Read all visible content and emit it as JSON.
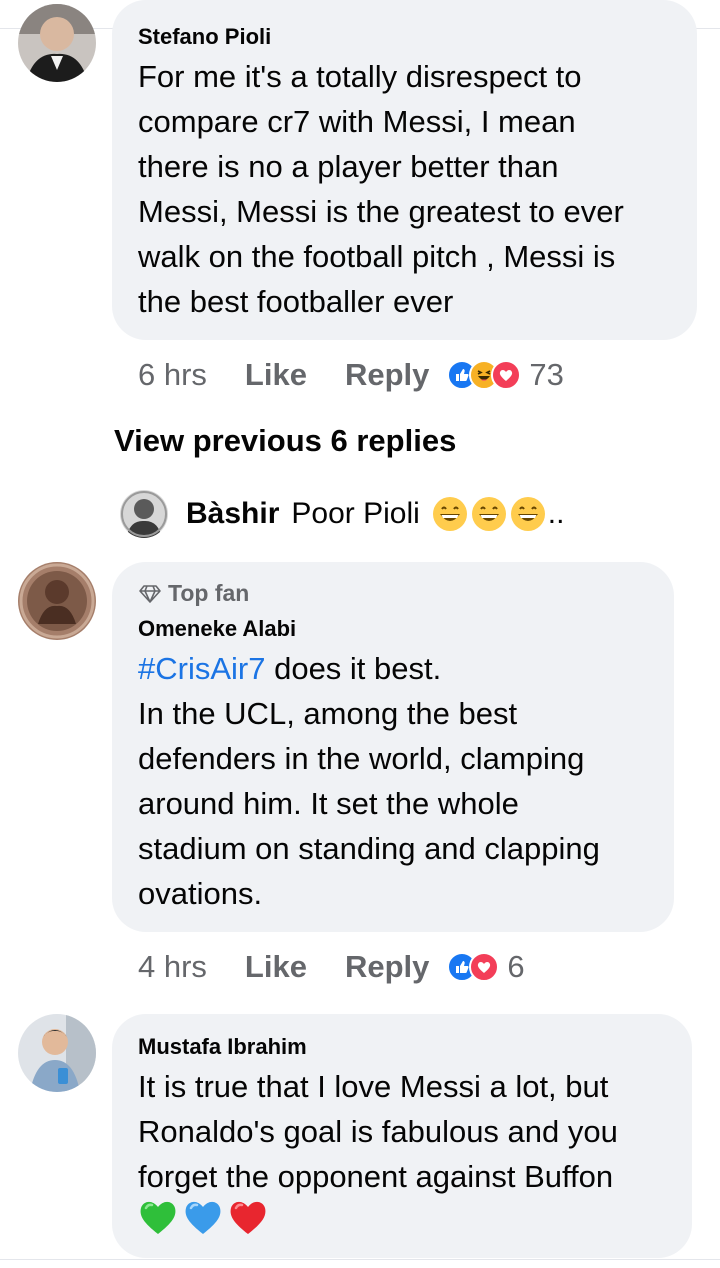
{
  "comments": [
    {
      "author": "Stefano Pioli",
      "lines": [
        "For me it's a totally disrespect to",
        "compare cr7 with Messi, I mean",
        "there is no a player better than",
        "Messi, Messi is the greatest to ever",
        "walk on the football pitch , Messi is",
        "the best footballer ever"
      ],
      "time": "6 hrs",
      "like_label": "Like",
      "reply_label": "Reply",
      "reactions": [
        "like-icon",
        "haha-icon",
        "love-icon"
      ],
      "reaction_count": "73"
    },
    {
      "badge_icon": "diamond-icon",
      "badge": "Top fan",
      "author": "Omeneke Alabi",
      "hashtag": "#CrisAir7",
      "first_line_rest": " does it best.",
      "lines": [
        "In the UCL, among the best",
        "defenders in the world, clamping",
        "around him. It set the whole",
        "stadium on standing and clapping",
        "ovations."
      ],
      "time": "4 hrs",
      "like_label": "Like",
      "reply_label": "Reply",
      "reactions": [
        "like-icon",
        "love-icon"
      ],
      "reaction_count": "6"
    },
    {
      "author": "Mustafa Ibrahim",
      "lines": [
        "It is true that I love Messi a lot, but",
        "Ronaldo's goal is fabulous and you",
        "forget the opponent against Buffon"
      ],
      "emojis": [
        "green-heart-icon",
        "blue-heart-icon",
        "red-heart-icon"
      ]
    }
  ],
  "view_previous": "View previous 6 replies",
  "reply_preview": {
    "author": "Bàshir",
    "text": "Poor Pioli",
    "emojis": [
      "grinning-face-icon",
      "grinning-face-icon",
      "grinning-face-icon"
    ],
    "ellipsis": ".."
  },
  "colors": {
    "bubble": "#f0f2f5",
    "like_blue": "#1877f2",
    "love_red": "#f33e58",
    "haha_yellow": "#f7b125",
    "hashtag_blue": "#1b74e4",
    "meta_gray": "#65676b"
  }
}
